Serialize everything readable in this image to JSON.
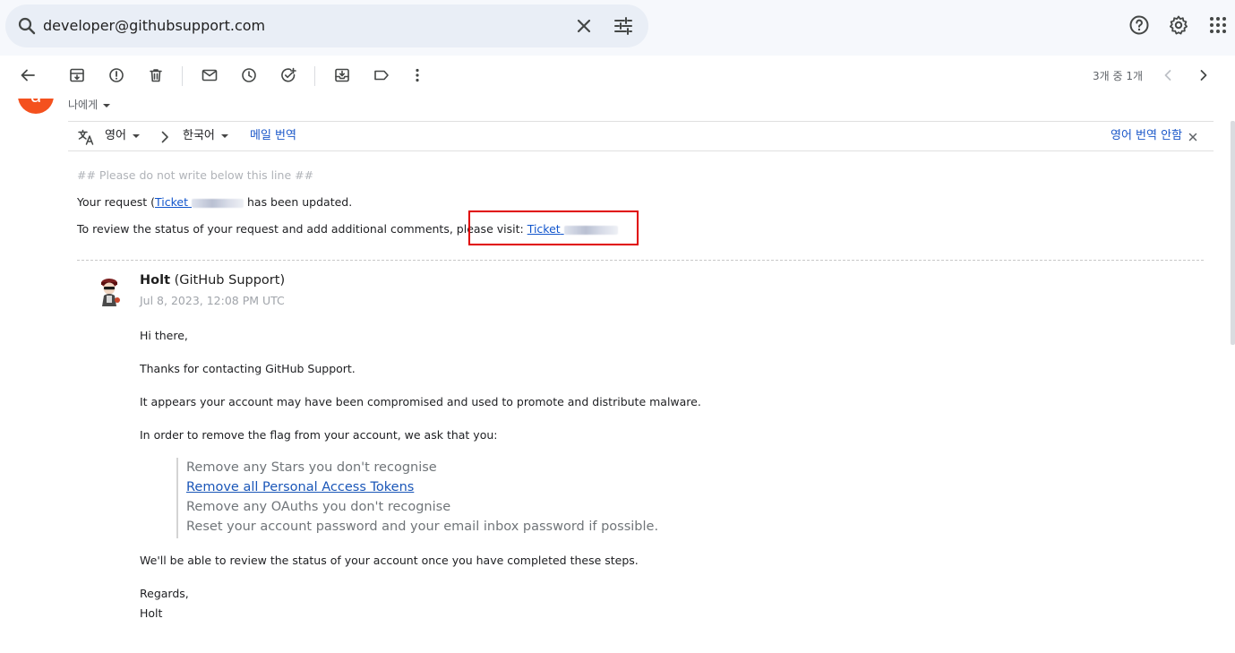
{
  "search": {
    "query": "developer@githubsupport.com"
  },
  "toolbar": {
    "pagination": "3개 중 1개"
  },
  "header": {
    "avatar_letter": "d",
    "recipient": "나에게"
  },
  "translate": {
    "source_lang": "영어",
    "target_lang": "한국어",
    "translate_message": "메일 번역",
    "dont_translate": "영어 번역 안함"
  },
  "email": {
    "notice": "## Please do not write below this line ##",
    "request_prefix": "Your request (",
    "ticket_label": "Ticket",
    "request_suffix": "has been updated.",
    "review_text": "To review the status of your request and add additional comments, please visit:",
    "review_link": "Ticket",
    "author_name": "Holt",
    "author_org": "(GitHub Support)",
    "date": "Jul 8, 2023, 12:08 PM UTC",
    "greeting": "Hi there,",
    "thanks": "Thanks for contacting GitHub Support.",
    "compromised": "It appears your account may have been compromised and used to promote and distribute malware.",
    "instruction": "In order to remove the flag from your account, we ask that you:",
    "steps": [
      "Remove any Stars you don't recognise",
      "Remove all Personal Access Tokens",
      "Remove any OAuths you don't recognise",
      "Reset your account password and your email inbox password if possible."
    ],
    "closing": "We'll be able to review the status of your account once you have completed these steps.",
    "regards": "Regards,",
    "signature": "Holt"
  },
  "colors": {
    "link": "#1155cc",
    "highlight_box": "#e00000",
    "avatar": "#f4511e"
  },
  "icons": [
    "search-icon",
    "close-icon",
    "tune-icon",
    "help-icon",
    "settings-icon",
    "apps-icon",
    "back-arrow-icon",
    "archive-icon",
    "report-spam-icon",
    "delete-icon",
    "mark-unread-icon",
    "snooze-icon",
    "add-task-icon",
    "move-to-icon",
    "label-icon",
    "more-vert-icon",
    "chevron-left-icon",
    "chevron-right-icon",
    "translate-icon",
    "chevron-right-small-icon"
  ]
}
